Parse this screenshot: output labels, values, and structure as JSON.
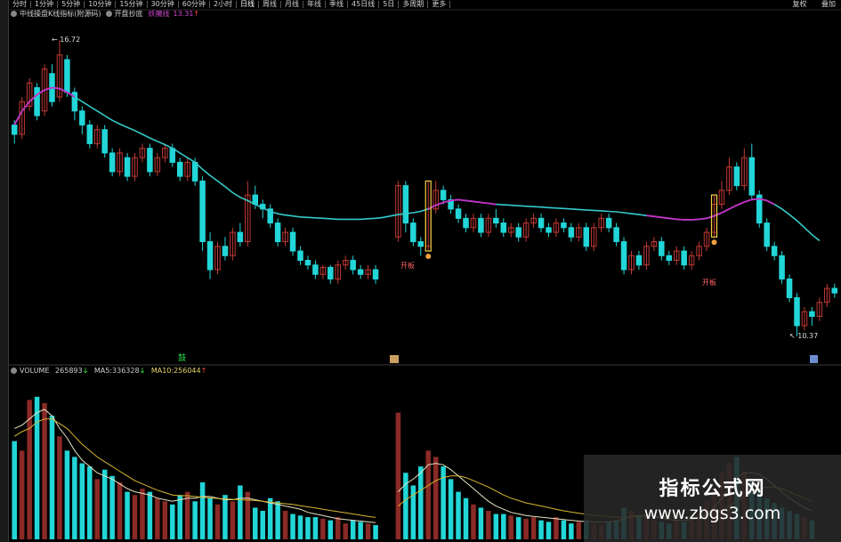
{
  "tabs": [
    "分时",
    "1分钟",
    "5分钟",
    "10分钟",
    "15分钟",
    "30分钟",
    "60分钟",
    "2小时",
    "日线",
    "周线",
    "月线",
    "年线",
    "季线",
    "45日线",
    "5日",
    "多周期",
    "更多"
  ],
  "active_tab": "日线",
  "top_right": {
    "left": "复权",
    "right": "叠加"
  },
  "indicator_header": {
    "name": "中线操盘K线指标(附源码)",
    "sub": "开盘抄底",
    "line_label": "妖魔线",
    "line_value": "13.31",
    "line_arrow": "↑"
  },
  "price_labels": {
    "high": "16.72",
    "low": "10.37"
  },
  "signal_label": "开板",
  "marker_left": "鼓",
  "volume_header": {
    "title": "VOLUME",
    "vol": "265893",
    "vol_arrow": "↓",
    "ma5_label": "MA5:",
    "ma5": "336328",
    "ma5_arrow": "↓",
    "ma10_label": "MA10:",
    "ma10": "256044",
    "ma10_arrow": "↑"
  },
  "watermark": {
    "title": "指标公式网",
    "url": "www.zbgs3.com"
  },
  "colors": {
    "up": "#c03a34",
    "down": "#22d6d8",
    "ma_cyan": "#35c9c9",
    "ma_purple": "#c530c7",
    "vol_ma5": "#e6e3c3",
    "vol_ma10": "#d8b730",
    "signal_yellow": "#f0d040"
  },
  "chart_data": {
    "type": "candlestick",
    "price_range": [
      10.37,
      16.72
    ],
    "candles": [
      [
        14.9,
        14.7,
        15.0,
        14.5
      ],
      [
        14.7,
        15.4,
        15.5,
        14.6
      ],
      [
        15.3,
        15.8,
        15.9,
        15.2
      ],
      [
        15.7,
        15.1,
        15.8,
        15.0
      ],
      [
        15.2,
        16.1,
        16.2,
        15.1
      ],
      [
        16.0,
        15.4,
        16.2,
        15.3
      ],
      [
        15.5,
        16.4,
        16.72,
        15.4
      ],
      [
        16.3,
        15.6,
        16.4,
        15.5
      ],
      [
        15.6,
        15.2,
        15.7,
        15.0
      ],
      [
        15.2,
        14.9,
        15.3,
        14.7
      ],
      [
        14.9,
        14.5,
        15.0,
        14.4
      ],
      [
        14.5,
        14.8,
        14.9,
        14.4
      ],
      [
        14.8,
        14.3,
        14.9,
        14.2
      ],
      [
        14.3,
        13.9,
        14.4,
        13.8
      ],
      [
        13.9,
        14.3,
        14.4,
        13.8
      ],
      [
        14.2,
        13.8,
        14.3,
        13.7
      ],
      [
        13.8,
        14.2,
        14.3,
        13.7
      ],
      [
        14.2,
        14.4,
        14.5,
        14.1
      ],
      [
        14.4,
        13.9,
        14.5,
        13.8
      ],
      [
        13.9,
        14.2,
        14.3,
        13.8
      ],
      [
        14.2,
        14.4,
        14.5,
        14.1
      ],
      [
        14.4,
        14.1,
        14.5,
        14.0
      ],
      [
        14.1,
        13.8,
        14.2,
        13.7
      ],
      [
        13.8,
        14.1,
        14.2,
        13.7
      ],
      [
        14.1,
        13.7,
        14.2,
        13.6
      ],
      [
        13.7,
        12.4,
        13.8,
        12.2
      ],
      [
        12.4,
        11.8,
        12.6,
        11.6
      ],
      [
        11.8,
        12.3,
        12.4,
        11.7
      ],
      [
        12.3,
        12.1,
        12.5,
        12.0
      ],
      [
        12.1,
        12.6,
        12.7,
        12.0
      ],
      [
        12.6,
        12.4,
        12.8,
        12.3
      ],
      [
        12.4,
        13.4,
        13.7,
        12.3
      ],
      [
        13.4,
        13.2,
        13.6,
        13.1
      ],
      [
        13.2,
        13.1,
        13.3,
        12.9
      ],
      [
        13.1,
        12.8,
        13.2,
        12.7
      ],
      [
        12.8,
        12.4,
        12.9,
        12.3
      ],
      [
        12.4,
        12.6,
        12.7,
        12.3
      ],
      [
        12.6,
        12.2,
        12.7,
        12.1
      ],
      [
        12.2,
        12.0,
        12.3,
        11.9
      ],
      [
        12.0,
        11.9,
        12.1,
        11.8
      ],
      [
        11.9,
        11.7,
        12.0,
        11.6
      ],
      [
        11.7,
        11.85,
        11.9,
        11.6
      ],
      [
        11.85,
        11.6,
        11.9,
        11.5
      ],
      [
        11.6,
        11.9,
        12.0,
        11.5
      ],
      [
        11.9,
        12.0,
        12.1,
        11.8
      ],
      [
        12.0,
        11.8,
        12.1,
        11.7
      ],
      [
        11.8,
        11.7,
        11.9,
        11.6
      ],
      [
        11.7,
        11.8,
        11.9,
        11.6
      ],
      [
        11.8,
        11.6,
        11.9,
        11.5
      ],
      null,
      null,
      [
        12.5,
        13.6,
        13.7,
        12.4
      ],
      [
        13.6,
        12.8,
        13.7,
        12.6
      ],
      [
        12.8,
        12.4,
        12.9,
        12.3
      ],
      [
        12.4,
        12.3,
        12.5,
        12.1
      ],
      [
        12.3,
        13.1,
        13.7,
        12.2
      ],
      [
        13.1,
        13.5,
        13.7,
        13.0
      ],
      [
        13.5,
        13.3,
        13.6,
        13.2
      ],
      [
        13.3,
        13.1,
        13.4,
        13.0
      ],
      [
        13.1,
        12.9,
        13.2,
        12.8
      ],
      [
        12.9,
        12.7,
        13.0,
        12.6
      ],
      [
        12.7,
        12.9,
        13.0,
        12.6
      ],
      [
        12.9,
        12.6,
        13.0,
        12.5
      ],
      [
        12.6,
        12.9,
        13.0,
        12.5
      ],
      [
        12.9,
        12.8,
        13.1,
        12.7
      ],
      [
        12.8,
        12.6,
        12.9,
        12.5
      ],
      [
        12.6,
        12.7,
        12.8,
        12.5
      ],
      [
        12.7,
        12.5,
        12.8,
        12.4
      ],
      [
        12.5,
        12.8,
        12.9,
        12.4
      ],
      [
        12.8,
        12.9,
        13.0,
        12.7
      ],
      [
        12.9,
        12.7,
        13.0,
        12.6
      ],
      [
        12.7,
        12.6,
        12.8,
        12.5
      ],
      [
        12.6,
        12.8,
        12.9,
        12.5
      ],
      [
        12.8,
        12.7,
        12.9,
        12.6
      ],
      [
        12.7,
        12.5,
        12.8,
        12.4
      ],
      [
        12.5,
        12.7,
        12.8,
        12.4
      ],
      [
        12.7,
        12.3,
        12.8,
        12.2
      ],
      [
        12.3,
        12.7,
        12.8,
        12.2
      ],
      [
        12.7,
        12.9,
        13.0,
        12.6
      ],
      [
        12.9,
        12.7,
        13.0,
        12.6
      ],
      [
        12.7,
        12.4,
        12.8,
        12.3
      ],
      [
        12.4,
        11.8,
        12.5,
        11.7
      ],
      [
        11.8,
        12.1,
        12.2,
        11.7
      ],
      [
        12.1,
        11.9,
        12.2,
        11.8
      ],
      [
        11.9,
        12.3,
        12.4,
        11.8
      ],
      [
        12.3,
        12.4,
        12.5,
        12.2
      ],
      [
        12.4,
        12.1,
        12.5,
        12.0
      ],
      [
        12.1,
        12.0,
        12.2,
        11.9
      ],
      [
        12.0,
        12.2,
        12.3,
        11.9
      ],
      [
        12.2,
        11.9,
        12.3,
        11.8
      ],
      [
        11.9,
        12.1,
        12.2,
        11.8
      ],
      [
        12.1,
        12.3,
        12.4,
        12.0
      ],
      [
        12.3,
        12.6,
        12.7,
        12.2
      ],
      [
        12.6,
        13.2,
        13.4,
        12.5
      ],
      [
        13.2,
        13.5,
        13.7,
        13.1
      ],
      [
        13.5,
        14.0,
        14.2,
        13.4
      ],
      [
        14.0,
        13.6,
        14.1,
        13.5
      ],
      [
        13.6,
        14.2,
        14.4,
        13.5
      ],
      [
        14.2,
        13.4,
        14.5,
        13.3
      ],
      [
        13.4,
        12.8,
        13.5,
        12.7
      ],
      [
        12.8,
        12.3,
        12.9,
        12.2
      ],
      [
        12.3,
        12.1,
        12.4,
        12.0
      ],
      [
        12.1,
        11.6,
        12.2,
        11.5
      ],
      [
        11.6,
        11.2,
        11.7,
        11.1
      ],
      [
        11.2,
        10.6,
        11.3,
        10.37
      ],
      [
        10.6,
        10.9,
        11.0,
        10.5
      ],
      [
        10.9,
        10.8,
        11.0,
        10.6
      ],
      [
        10.8,
        11.1,
        11.2,
        10.7
      ],
      [
        11.1,
        11.4,
        11.5,
        11.0
      ],
      [
        11.4,
        11.3,
        11.5,
        11.2
      ]
    ],
    "ma_main": [
      14.9,
      15.2,
      15.4,
      15.55,
      15.65,
      15.7,
      15.68,
      15.6,
      15.5,
      15.4,
      15.3,
      15.2,
      15.1,
      15.0,
      14.92,
      14.85,
      14.78,
      14.7,
      14.62,
      14.55,
      14.48,
      14.4,
      14.3,
      14.2,
      14.1,
      13.95,
      13.82,
      13.7,
      13.58,
      13.45,
      13.35,
      13.28,
      13.2,
      13.12,
      13.05,
      13.0,
      12.97,
      12.95,
      12.93,
      12.92,
      12.91,
      12.9,
      12.89,
      12.88,
      12.88,
      12.88,
      12.88,
      12.89,
      12.9,
      12.92,
      12.95,
      12.98,
      13.0,
      13.02,
      13.05,
      13.1,
      13.18,
      13.24,
      13.28,
      13.3,
      13.28,
      13.26,
      13.24,
      13.22,
      13.2,
      13.19,
      13.18,
      13.17,
      13.16,
      13.15,
      13.14,
      13.13,
      13.12,
      13.11,
      13.1,
      13.09,
      13.08,
      13.07,
      13.06,
      13.05,
      13.04,
      13.02,
      13.0,
      12.98,
      12.96,
      12.94,
      12.92,
      12.9,
      12.88,
      12.87,
      12.87,
      12.88,
      12.9,
      12.95,
      13.02,
      13.1,
      13.18,
      13.25,
      13.3,
      13.32,
      13.28,
      13.2,
      13.1,
      12.98,
      12.85,
      12.7,
      12.55,
      12.42
    ],
    "ma_purple_segments": [
      [
        0,
        8
      ],
      [
        55,
        64
      ],
      [
        84,
        101
      ]
    ],
    "signal_boxes": [
      55,
      93
    ],
    "volume": {
      "range": [
        0,
        1000000
      ],
      "bars": [
        620,
        560,
        880,
        900,
        860,
        780,
        650,
        560,
        520,
        480,
        460,
        380,
        440,
        400,
        360,
        300,
        280,
        320,
        300,
        260,
        240,
        220,
        280,
        300,
        240,
        360,
        260,
        220,
        280,
        240,
        340,
        300,
        200,
        180,
        260,
        240,
        180,
        160,
        150,
        140,
        140,
        130,
        120,
        140,
        100,
        120,
        110,
        100,
        90,
        null,
        null,
        800,
        420,
        340,
        460,
        560,
        520,
        460,
        380,
        300,
        260,
        220,
        200,
        180,
        160,
        160,
        150,
        140,
        130,
        140,
        120,
        110,
        140,
        120,
        100,
        110,
        120,
        100,
        90,
        110,
        120,
        200,
        180,
        150,
        140,
        120,
        110,
        100,
        130,
        110,
        140,
        160,
        240,
        300,
        420,
        480,
        520,
        430,
        360,
        300,
        260,
        230,
        200,
        180,
        160,
        140,
        120
      ],
      "ma5": [
        700,
        720,
        760,
        800,
        820,
        780,
        700,
        640,
        560,
        500,
        460,
        420,
        400,
        380,
        350,
        320,
        300,
        290,
        280,
        260,
        250,
        240,
        250,
        260,
        260,
        270,
        270,
        260,
        250,
        250,
        260,
        260,
        250,
        240,
        230,
        220,
        210,
        200,
        190,
        170,
        160,
        150,
        140,
        130,
        125,
        120,
        115,
        110,
        105,
        null,
        null,
        300,
        350,
        380,
        420,
        470,
        480,
        470,
        440,
        400,
        360,
        320,
        280,
        240,
        210,
        190,
        170,
        160,
        150,
        145,
        140,
        135,
        130,
        125,
        120,
        115,
        112,
        110,
        108,
        110,
        115,
        130,
        145,
        150,
        150,
        145,
        135,
        125,
        120,
        120,
        125,
        135,
        160,
        200,
        260,
        330,
        390,
        420,
        420,
        410,
        380,
        340,
        300,
        260,
        230,
        200,
        180
      ],
      "ma10": [
        650,
        680,
        700,
        740,
        760,
        760,
        730,
        700,
        650,
        600,
        560,
        520,
        490,
        460,
        430,
        400,
        370,
        350,
        330,
        310,
        295,
        280,
        275,
        275,
        270,
        265,
        262,
        258,
        255,
        252,
        250,
        248,
        245,
        240,
        235,
        230,
        225,
        220,
        212,
        205,
        198,
        190,
        182,
        175,
        168,
        160,
        152,
        145,
        138,
        null,
        null,
        210,
        250,
        280,
        310,
        340,
        370,
        390,
        400,
        400,
        390,
        370,
        350,
        330,
        305,
        280,
        260,
        245,
        230,
        220,
        210,
        200,
        190,
        180,
        172,
        165,
        158,
        152,
        147,
        143,
        140,
        140,
        142,
        144,
        145,
        145,
        144,
        142,
        140,
        138,
        138,
        140,
        148,
        160,
        180,
        210,
        240,
        270,
        300,
        320,
        330,
        330,
        320,
        300,
        280,
        260,
        240
      ]
    }
  }
}
